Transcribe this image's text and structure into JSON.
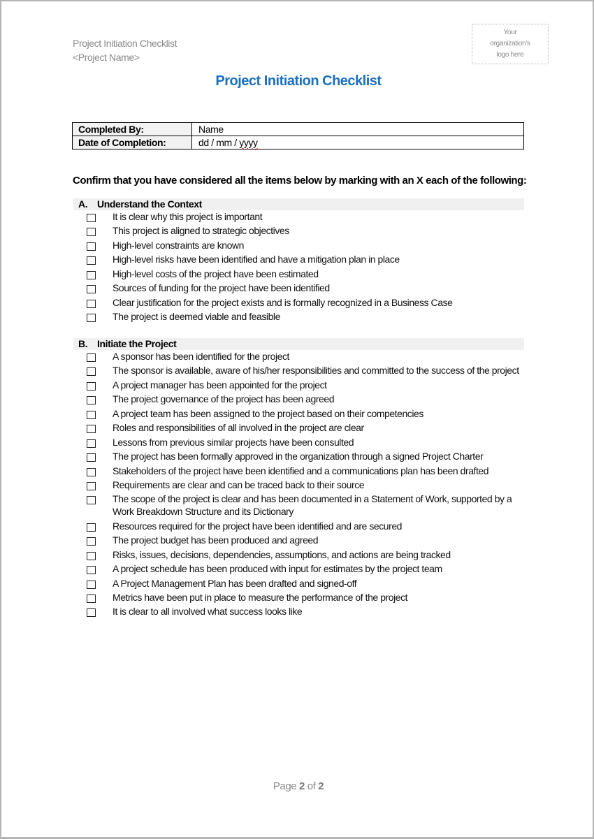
{
  "header": {
    "doc_name": "Project Initiation Checklist",
    "project_name": "<Project Name>",
    "logo_placeholder": [
      "Your",
      "organization's",
      "logo here"
    ]
  },
  "title": "Project Initiation Checklist",
  "info_table": {
    "rows": [
      {
        "label": "Completed By:",
        "value": "Name"
      },
      {
        "label": "Date of Completion:",
        "value_prefix": "dd / mm / ",
        "value_flagged": "yyyy"
      }
    ]
  },
  "instruction": "Confirm that you have considered all the items below by marking with an X each of the following:",
  "sections": [
    {
      "letter": "A.",
      "title": "Understand the Context",
      "items": [
        {
          "text": "It is clear why this project is important",
          "checked": false
        },
        {
          "text": "This project is aligned to strategic objectives",
          "checked": false
        },
        {
          "text": "High-level constraints are known",
          "checked": false
        },
        {
          "text": "High-level risks have been identified and have a mitigation plan in place",
          "checked": false
        },
        {
          "text": "High-level costs of the project have been estimated",
          "checked": false
        },
        {
          "text": "Sources of funding for the project have been identified",
          "checked": false
        },
        {
          "text": "Clear justification for the project exists and is formally recognized in a Business Case",
          "checked": false
        },
        {
          "text": "The project is deemed viable and feasible",
          "checked": false
        }
      ]
    },
    {
      "letter": "B.",
      "title": "Initiate the Project",
      "items": [
        {
          "text": "A sponsor has been identified for the project",
          "checked": false
        },
        {
          "text": "The sponsor is available, aware of his/her responsibilities and committed to the success of the project",
          "checked": false
        },
        {
          "text": "A project manager has been appointed for the project",
          "checked": false
        },
        {
          "text": "The project governance of the project has been agreed",
          "checked": false
        },
        {
          "text": "A project team has been assigned to the project based on their competencies",
          "checked": false
        },
        {
          "text": "Roles and responsibilities of all involved in the project are clear",
          "checked": false
        },
        {
          "text": "Lessons from previous similar projects have been consulted",
          "checked": false
        },
        {
          "text": "The project has been formally approved in the organization through a signed Project Charter",
          "checked": false
        },
        {
          "text": "Stakeholders of the project have been identified and a communications plan has been drafted",
          "checked": false
        },
        {
          "text": "Requirements are clear and can be traced back to their source",
          "checked": false
        },
        {
          "text": "The scope of the project is clear and has been documented in a Statement of Work, supported by a Work Breakdown Structure and its Dictionary",
          "checked": false
        },
        {
          "text": "Resources required for the project have been identified and are secured",
          "checked": false
        },
        {
          "text": "The project budget has been produced and agreed",
          "checked": false
        },
        {
          "text": "Risks, issues, decisions, dependencies, assumptions, and actions are being tracked",
          "checked": false
        },
        {
          "text": "A project schedule has been produced with input for estimates by the project team",
          "checked": false
        },
        {
          "text": "A Project Management Plan has been drafted and signed-off",
          "checked": false
        },
        {
          "text": "Metrics have been put in place to measure the performance of the project",
          "checked": false
        },
        {
          "text": "It is clear to all involved what success looks like",
          "checked": false
        }
      ]
    }
  ],
  "footer": {
    "prefix": "Page ",
    "current": "2",
    "middle": " of ",
    "total": "2"
  },
  "colors": {
    "title_blue": "#1b6fc0",
    "header_gray": "#8a8a8a",
    "section_band": "#f0f0f0",
    "spellcheck_red": "#d02020"
  }
}
